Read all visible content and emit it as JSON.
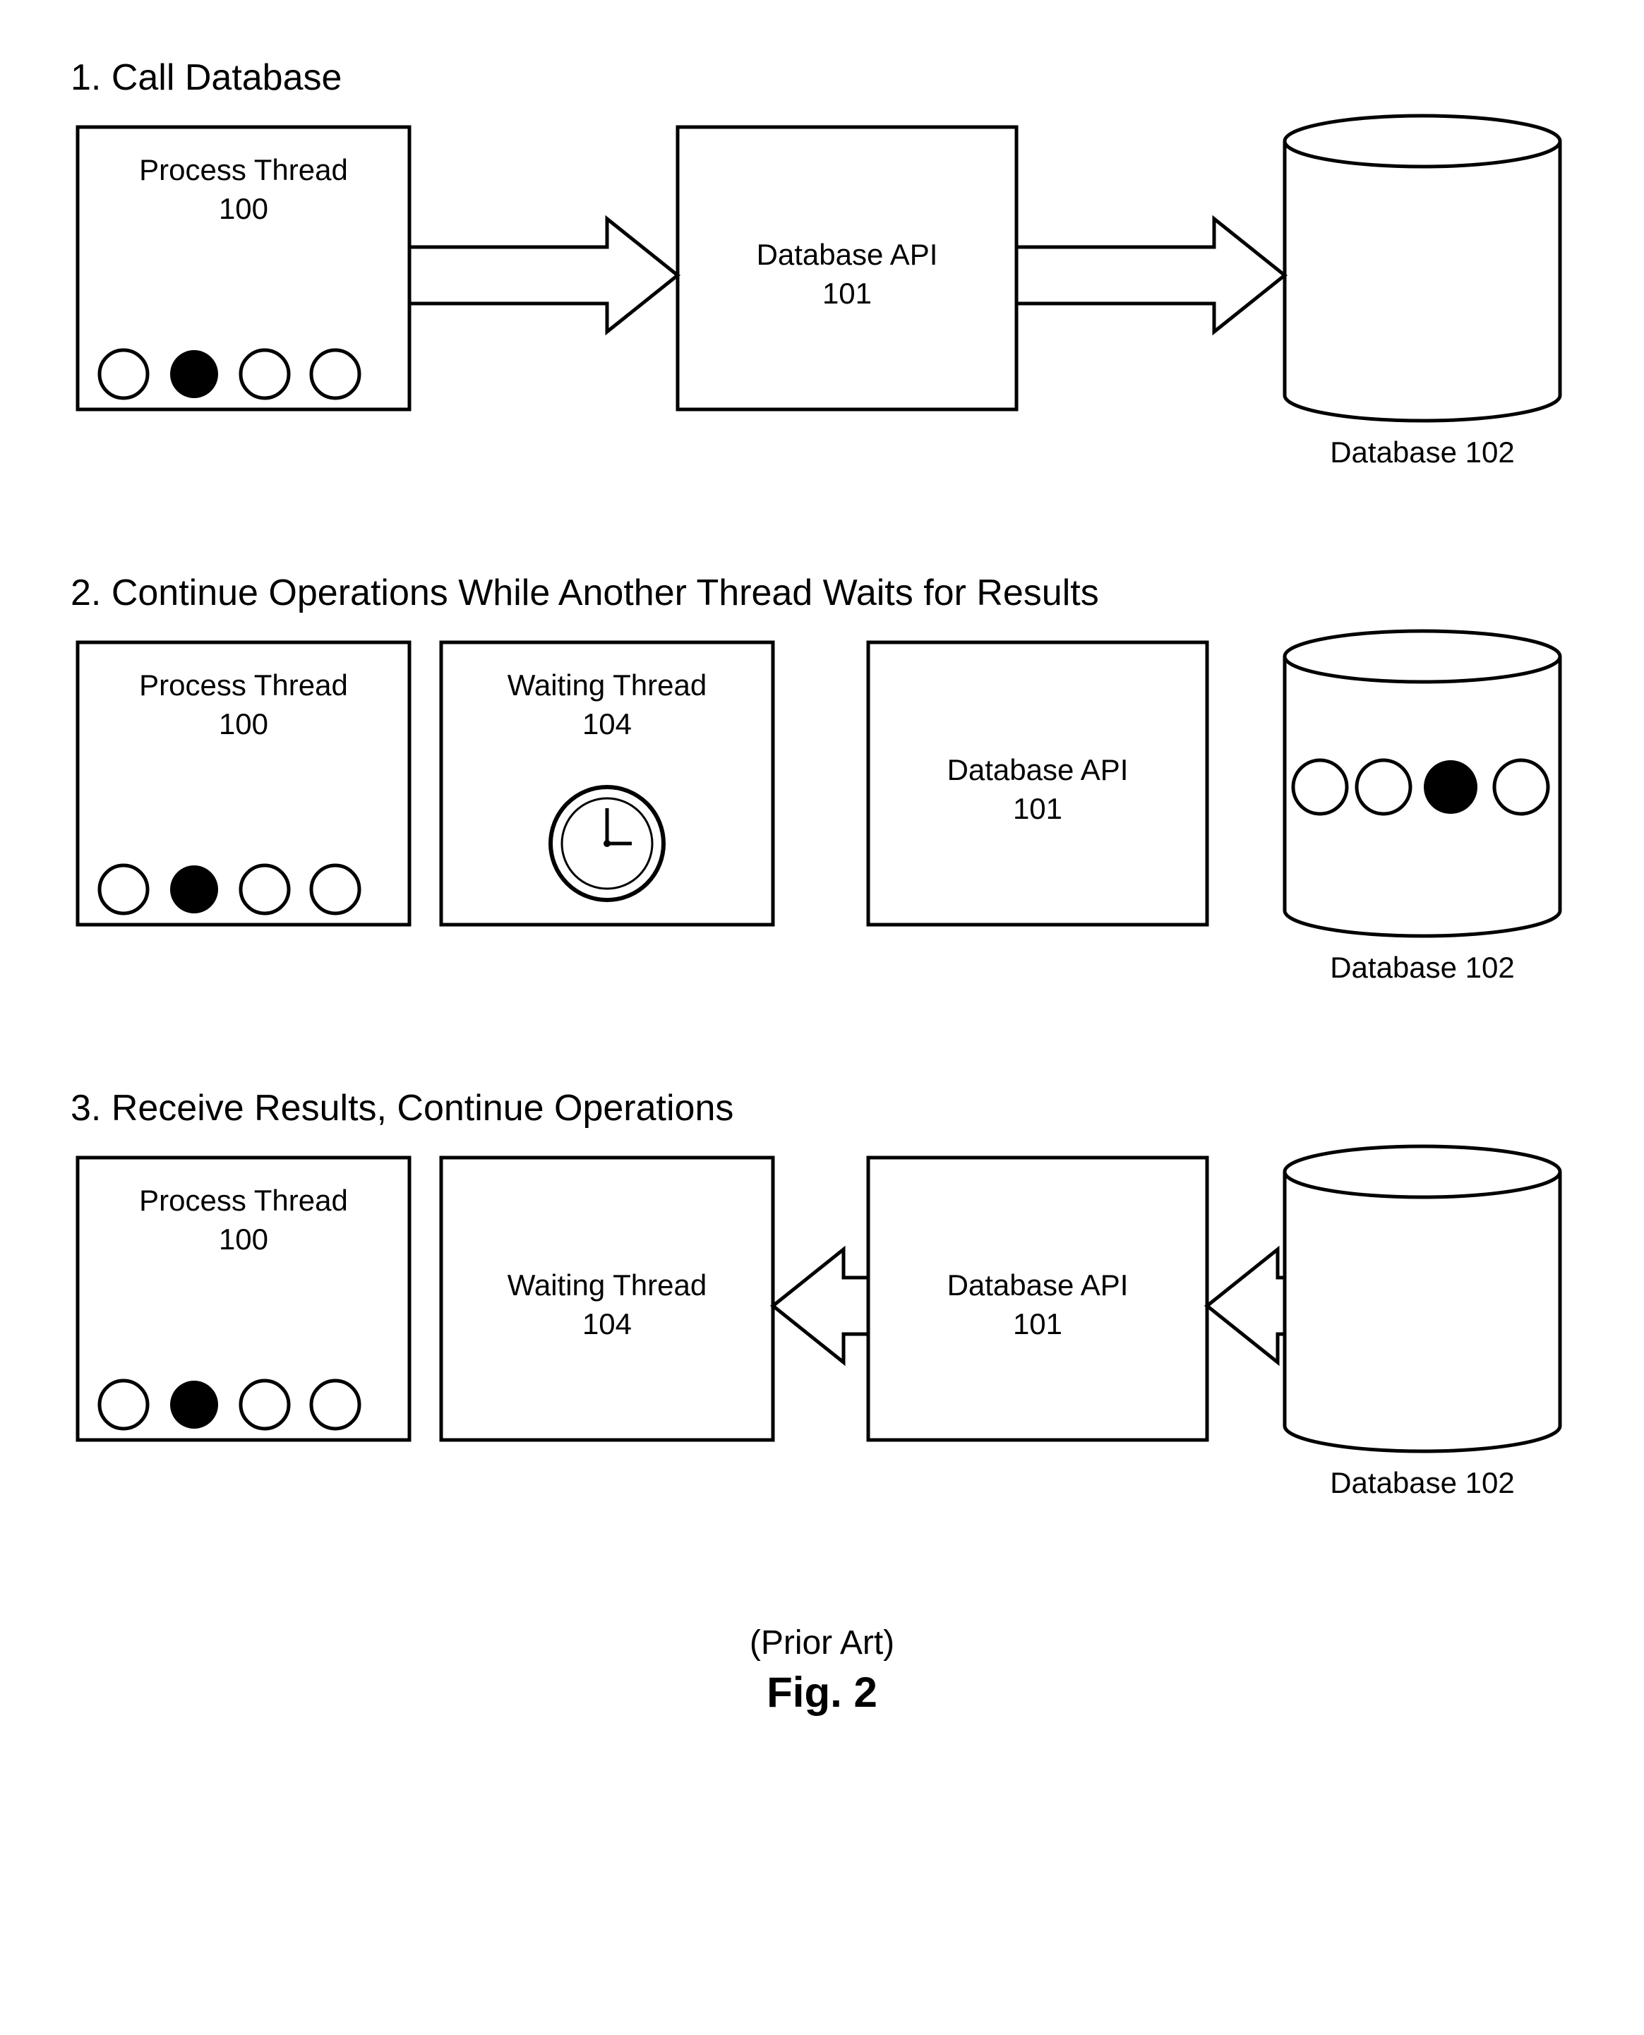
{
  "figure": {
    "caption_top": "(Prior Art)",
    "caption_bottom": "Fig. 2"
  },
  "sections": {
    "s1": {
      "title": "1. Call Database"
    },
    "s2": {
      "title": "2. Continue Operations While Another Thread Waits for Results"
    },
    "s3": {
      "title": "3. Receive Results, Continue Operations"
    }
  },
  "boxes": {
    "process_thread": {
      "line1": "Process Thread",
      "line2": "100"
    },
    "database_api": {
      "line1": "Database API",
      "line2": "101"
    },
    "waiting_thread": {
      "line1": "Waiting Thread",
      "line2": "104"
    },
    "database": {
      "label": "Database 102"
    }
  }
}
